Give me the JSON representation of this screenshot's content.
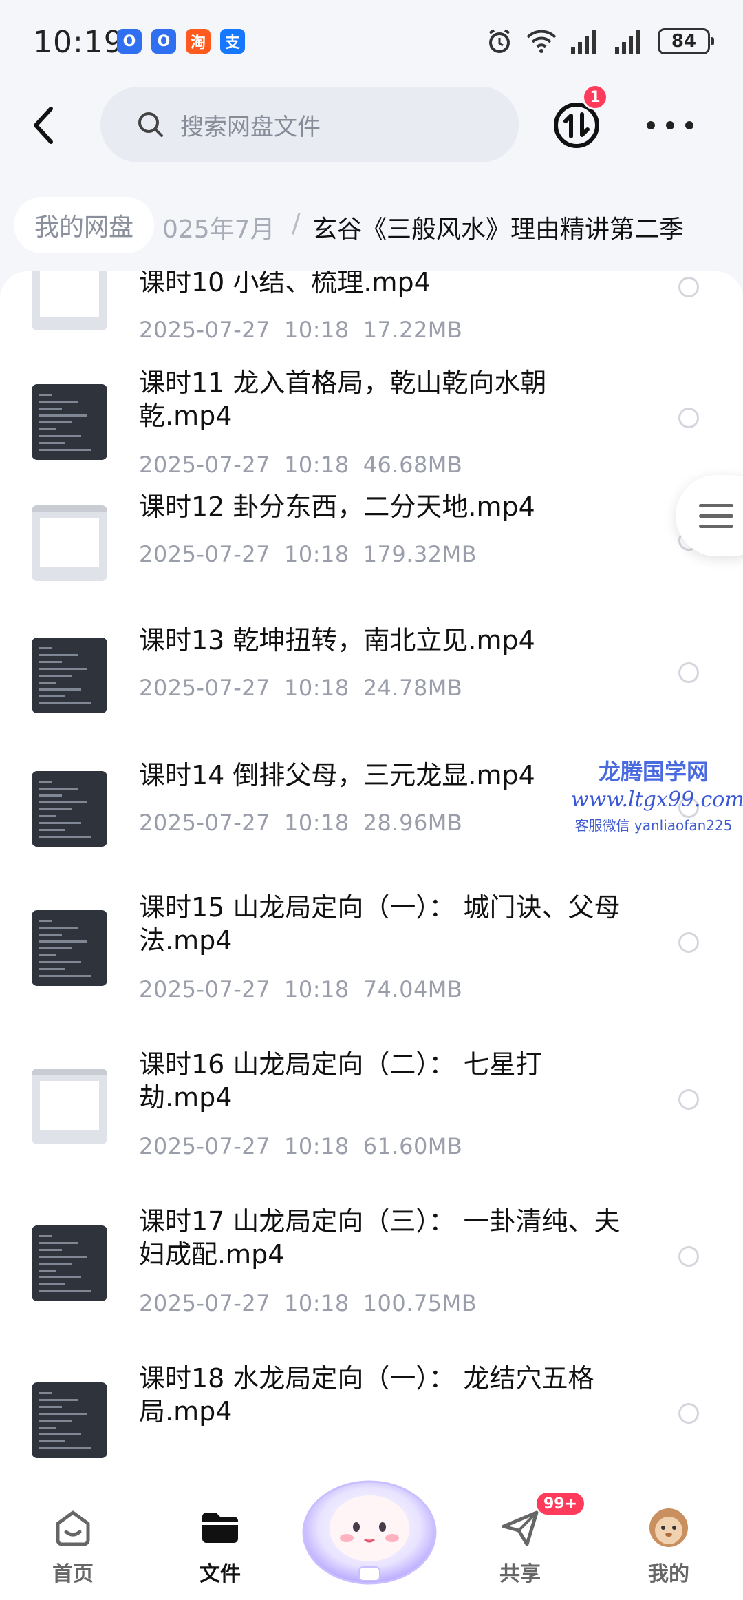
{
  "status_bar": {
    "time": "10:19",
    "app_icons": [
      {
        "name": "app-o-blue-icon",
        "glyph": "O",
        "color": "#2f6ff0"
      },
      {
        "name": "app-o-blue-icon",
        "glyph": "O",
        "color": "#2f6ff0"
      },
      {
        "name": "taobao-icon",
        "glyph": "淘",
        "color": "#ff5a1e"
      },
      {
        "name": "alipay-icon",
        "glyph": "支",
        "color": "#1677ff"
      }
    ],
    "battery": "84"
  },
  "header": {
    "search_placeholder": "搜索网盘文件",
    "transfer_badge": "1"
  },
  "breadcrumb": {
    "root": "我的网盘",
    "middle": "025年7月",
    "separator": "/",
    "current": "玄谷《三般风水》理由精讲第二季"
  },
  "files": [
    {
      "name": "课时10 小结、梳理.mp4",
      "date": "2025-07-27",
      "time": "10:18",
      "size": "17.22MB",
      "thumb": "light"
    },
    {
      "name": "课时11 龙入首格局，乾山乾向水朝乾.mp4",
      "date": "2025-07-27",
      "time": "10:18",
      "size": "46.68MB",
      "thumb": "dark"
    },
    {
      "name": "课时12 卦分东西，二分天地.mp4",
      "date": "2025-07-27",
      "time": "10:18",
      "size": "179.32MB",
      "thumb": "light"
    },
    {
      "name": "课时13 乾坤扭转，南北立见.mp4",
      "date": "2025-07-27",
      "time": "10:18",
      "size": "24.78MB",
      "thumb": "dark"
    },
    {
      "name": "课时14 倒排父母，三元龙显.mp4",
      "date": "2025-07-27",
      "time": "10:18",
      "size": "28.96MB",
      "thumb": "dark"
    },
    {
      "name": "课时15 山龙局定向（一）： 城门诀、父母法.mp4",
      "date": "2025-07-27",
      "time": "10:18",
      "size": "74.04MB",
      "thumb": "dark"
    },
    {
      "name": "课时16 山龙局定向（二）： 七星打劫.mp4",
      "date": "2025-07-27",
      "time": "10:18",
      "size": "61.60MB",
      "thumb": "light"
    },
    {
      "name": "课时17 山龙局定向（三）： 一卦清纯、夫妇成配.mp4",
      "date": "2025-07-27",
      "time": "10:18",
      "size": "100.75MB",
      "thumb": "dark"
    },
    {
      "name": "课时18 水龙局定向（一）： 龙结穴五格局.mp4",
      "date": "",
      "time": "",
      "size": "",
      "thumb": "dark"
    }
  ],
  "watermark": {
    "title": "龙腾国学网",
    "url": "www.ltgx99.com",
    "contact": "客服微信 yanliaofan225"
  },
  "tab_bar": {
    "home": "首页",
    "files": "文件",
    "share": "共享",
    "share_badge": "99+",
    "mine": "我的"
  },
  "colors": {
    "accent_red": "#ff3b5c",
    "watermark_blue": "#3a57d6"
  }
}
